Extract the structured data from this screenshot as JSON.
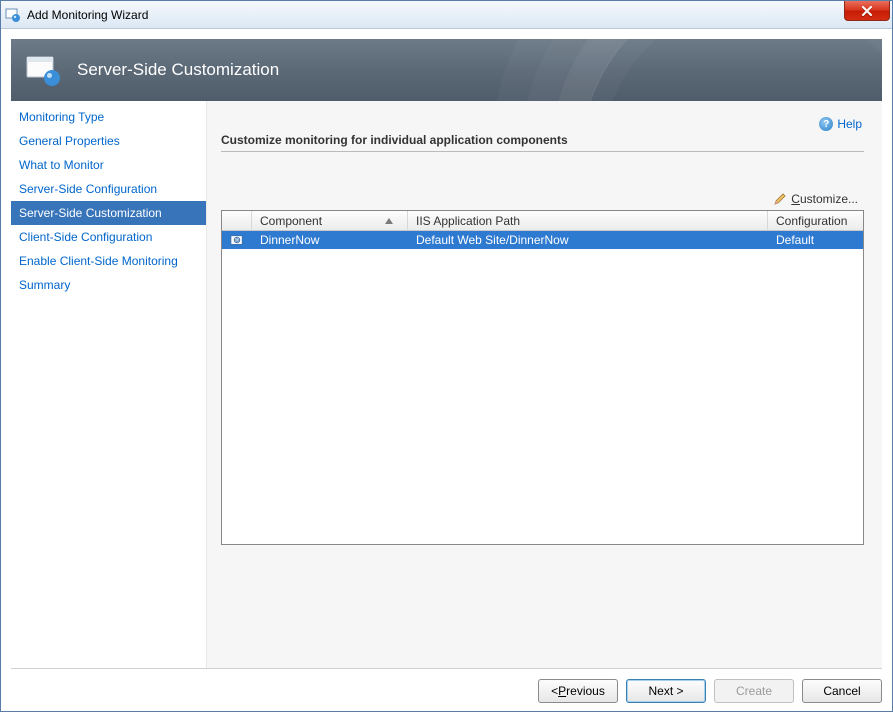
{
  "titlebar": {
    "title": "Add Monitoring Wizard"
  },
  "banner": {
    "title": "Server-Side Customization"
  },
  "help": {
    "label": "Help"
  },
  "sidebar": {
    "items": [
      {
        "label": "Monitoring Type"
      },
      {
        "label": "General Properties"
      },
      {
        "label": "What to Monitor"
      },
      {
        "label": "Server-Side Configuration"
      },
      {
        "label": "Server-Side Customization"
      },
      {
        "label": "Client-Side Configuration"
      },
      {
        "label": "Enable Client-Side Monitoring"
      },
      {
        "label": "Summary"
      }
    ],
    "selected_index": 4
  },
  "main": {
    "heading": "Customize monitoring for individual application components",
    "customize_label": "Customize..."
  },
  "table": {
    "columns": {
      "component": "Component",
      "iis_path": "IIS Application Path",
      "configuration": "Configuration"
    },
    "rows": [
      {
        "component": "DinnerNow",
        "iis_path": "Default Web Site/DinnerNow",
        "configuration": "Default"
      }
    ]
  },
  "buttons": {
    "previous_prefix": "< ",
    "previous_u": "P",
    "previous_rest": "revious",
    "next": "Next >",
    "create": "Create",
    "cancel": "Cancel"
  }
}
